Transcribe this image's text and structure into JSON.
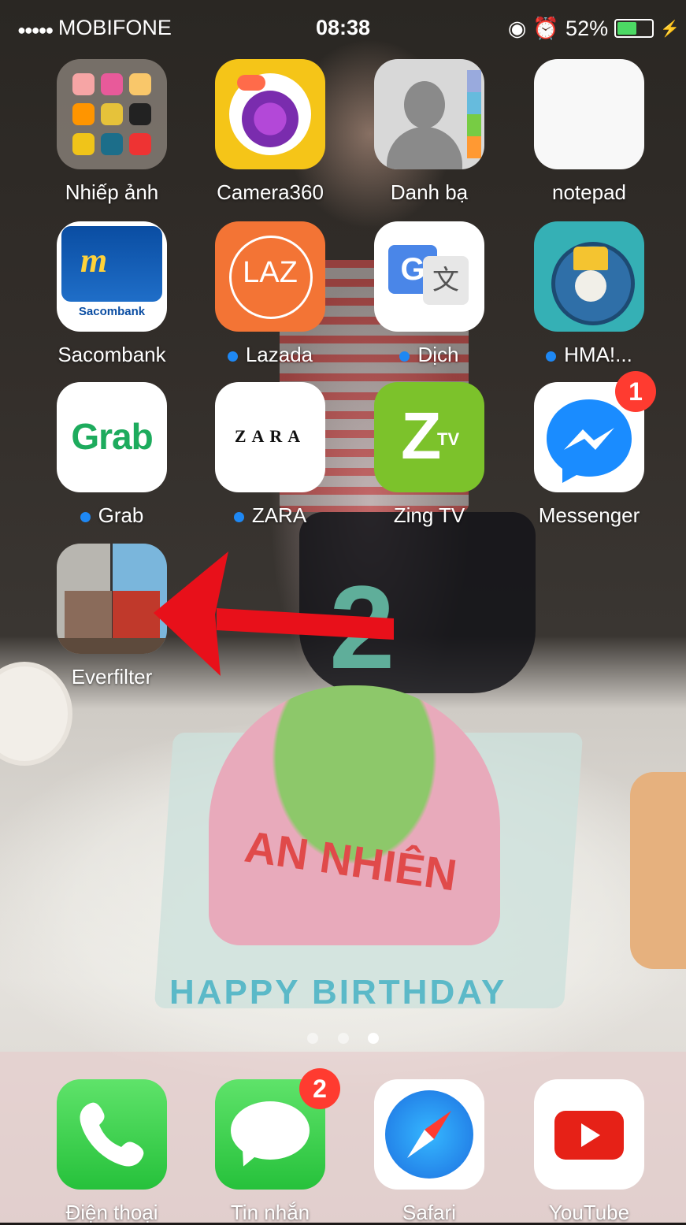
{
  "status_bar": {
    "signal": "●●●●●",
    "carrier": "MOBIFONE",
    "time": "08:38",
    "battery_percent": "52%",
    "battery_level": 0.52
  },
  "apps": [
    {
      "label": "Nhiếp ảnh",
      "icon": "photo-folder-icon"
    },
    {
      "label": "Camera360",
      "icon": "camera360-icon"
    },
    {
      "label": "Danh bạ",
      "icon": "contacts-icon"
    },
    {
      "label": "notepad",
      "icon": "notepad-icon"
    },
    {
      "label": "Sacombank",
      "icon": "sacombank-icon",
      "icon_text": "Sacombank"
    },
    {
      "label": "Lazada",
      "icon": "lazada-icon",
      "icon_text": "LAZ"
    },
    {
      "label": "Dịch",
      "icon": "google-translate-icon"
    },
    {
      "label": "HMA!...",
      "icon": "hma-icon"
    },
    {
      "label": "Grab",
      "icon": "grab-icon",
      "icon_text": "Grab"
    },
    {
      "label": "ZARA",
      "icon": "zara-icon",
      "icon_text": "ZARA"
    },
    {
      "label": "Zing TV",
      "icon": "zing-tv-icon",
      "icon_text": "Z",
      "icon_sub": "TV"
    },
    {
      "label": "Messenger",
      "icon": "messenger-icon",
      "badge": "1"
    },
    {
      "label": "Everfilter",
      "icon": "everfilter-icon"
    }
  ],
  "dock": [
    {
      "label": "Điện thoại",
      "icon": "phone-icon"
    },
    {
      "label": "Tin nhắn",
      "icon": "messages-icon",
      "badge": "2"
    },
    {
      "label": "Safari",
      "icon": "safari-icon"
    },
    {
      "label": "YouTube",
      "icon": "youtube-icon"
    }
  ],
  "page_indicator": {
    "pages": 3,
    "current": 3
  },
  "colors": {
    "badge": "#ff3b30",
    "arrow": "#e8101a",
    "update_dot": "#1e88f4"
  }
}
